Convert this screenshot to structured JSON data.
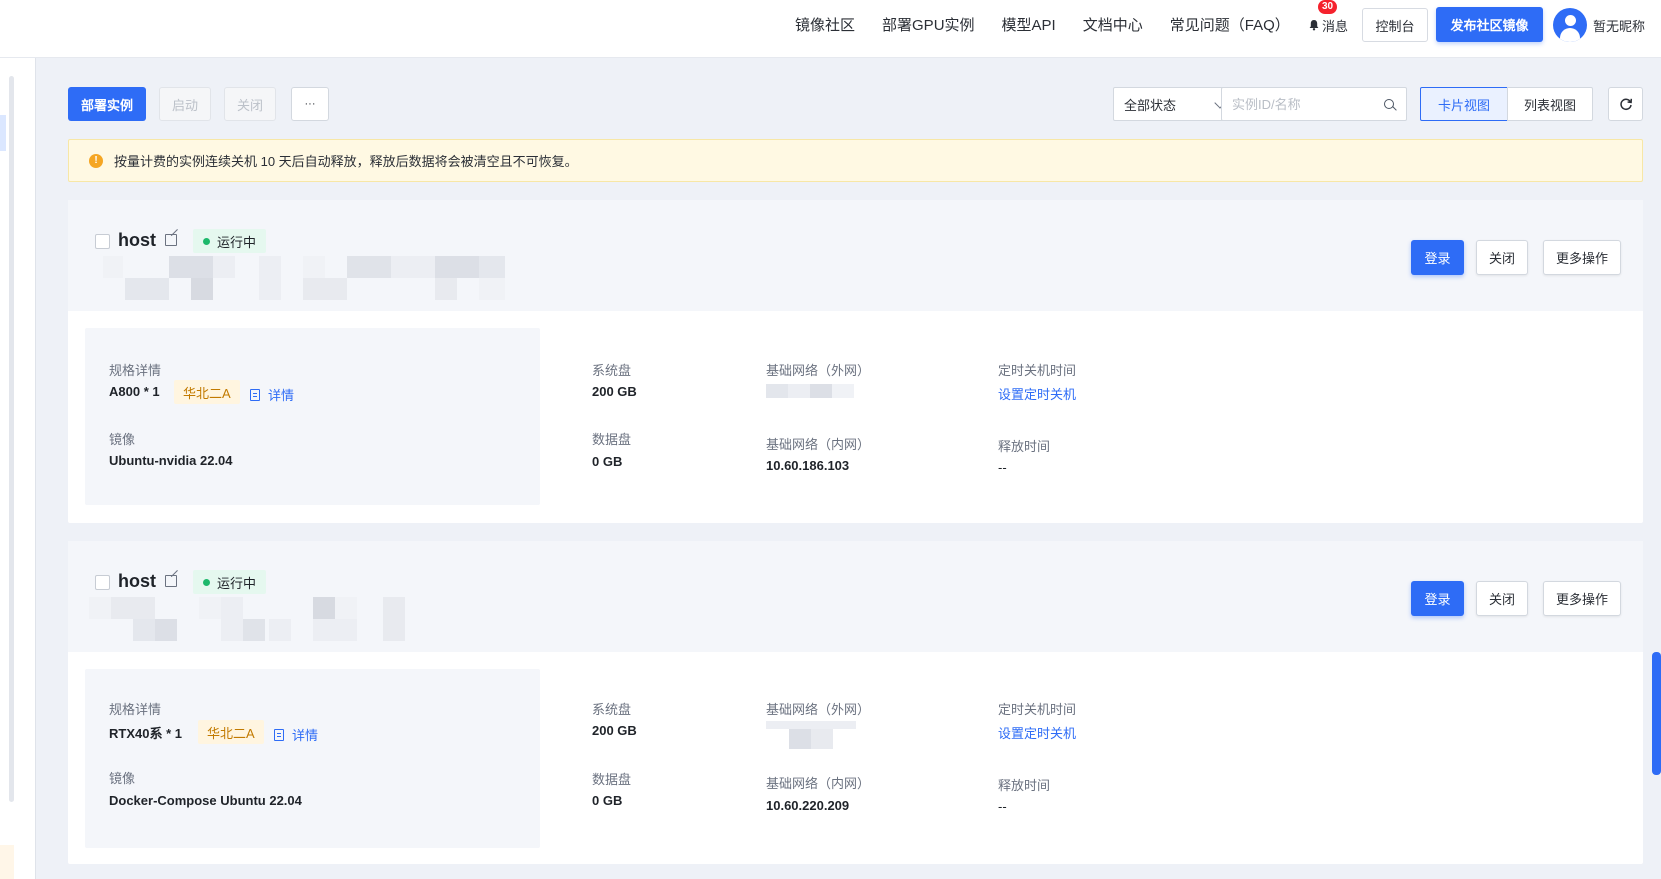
{
  "nav": {
    "links": [
      "镜像社区",
      "部署GPU实例",
      "模型API",
      "文档中心",
      "常见问题（FAQ）"
    ],
    "messages_label": "消息",
    "messages_badge": "30",
    "console_label": "控制台",
    "publish_label": "发布社区镜像",
    "user_name": "暂无昵称"
  },
  "toolbar": {
    "deploy_label": "部署实例",
    "start_label": "启动",
    "stop_label": "关闭",
    "more_label": "···",
    "status_filter": "全部状态",
    "search_placeholder": "实例ID/名称",
    "card_view_label": "卡片视图",
    "list_view_label": "列表视图"
  },
  "alert": {
    "text": "按量计费的实例连续关机 10 天后自动释放，释放后数据将会被清空且不可恢复。"
  },
  "labels": {
    "spec": "规格详情",
    "detail": "详情",
    "image": "镜像",
    "system_disk": "系统盘",
    "data_disk": "数据盘",
    "network_ext": "基础网络（外网）",
    "network_int": "基础网络（内网）",
    "schedule_shutdown": "定时关机时间",
    "release_time": "释放时间",
    "login": "登录",
    "close": "关闭",
    "more_ops": "更多操作"
  },
  "instances": [
    {
      "name": "host",
      "status": "运行中",
      "spec": "A800 * 1",
      "region": "华北二A",
      "image": "Ubuntu-nvidia 22.04",
      "system_disk": "200 GB",
      "data_disk": "0 GB",
      "network_int": "10.60.186.103",
      "schedule_link": "设置定时关机",
      "release_time": "--"
    },
    {
      "name": "host",
      "status": "运行中",
      "spec": "RTX40系 * 1",
      "region": "华北二A",
      "image": "Docker-Compose Ubuntu 22.04",
      "system_disk": "200 GB",
      "data_disk": "0 GB",
      "network_int": "10.60.220.209",
      "schedule_link": "设置定时关机",
      "release_time": "--"
    }
  ],
  "colors": {
    "primary": "#2e6cf6",
    "running": "#1db86b",
    "region_text": "#c27a00",
    "warning": "#f5a623"
  }
}
